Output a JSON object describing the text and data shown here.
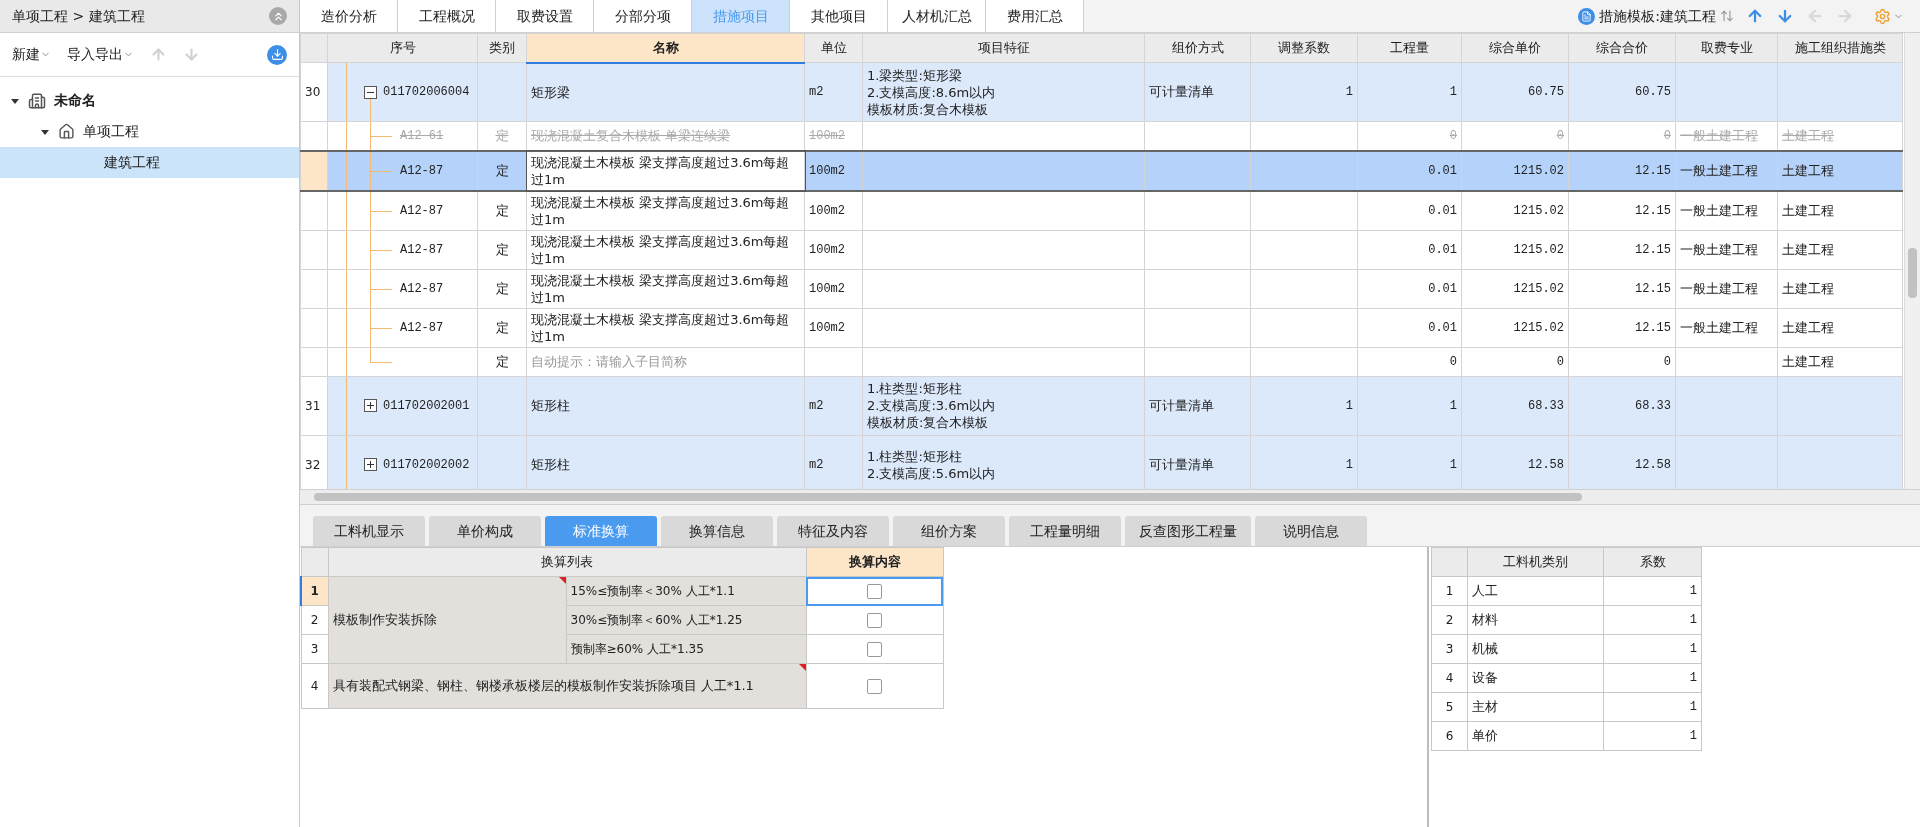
{
  "sidebar": {
    "breadcrumb": "单项工程 > 建筑工程",
    "menus": [
      {
        "label": "新建"
      },
      {
        "label": "导入导出"
      }
    ],
    "move_buttons": [
      {
        "kind": "up",
        "disabled": true
      },
      {
        "kind": "down",
        "disabled": true
      }
    ],
    "tree": [
      {
        "label": "未命名",
        "kind": "project",
        "expanded": true,
        "selected": false,
        "children": [
          {
            "label": "单项工程",
            "kind": "single",
            "expanded": true,
            "selected": false,
            "children": [
              {
                "label": "建筑工程",
                "selected": true
              }
            ]
          }
        ]
      }
    ]
  },
  "tabs": [
    {
      "label": "造价分析",
      "selected": false
    },
    {
      "label": "工程概况",
      "selected": false
    },
    {
      "label": "取费设置",
      "selected": false
    },
    {
      "label": "分部分项",
      "selected": false
    },
    {
      "label": "措施项目",
      "selected": true
    },
    {
      "label": "其他项目",
      "selected": false
    },
    {
      "label": "人材机汇总",
      "selected": false
    },
    {
      "label": "费用汇总",
      "selected": false
    }
  ],
  "template_selector": {
    "label": "措施模板:建筑工程"
  },
  "nav_buttons": [
    {
      "kind": "up",
      "disabled": false
    },
    {
      "kind": "down",
      "disabled": false
    },
    {
      "kind": "left",
      "disabled": true
    },
    {
      "kind": "right",
      "disabled": true
    }
  ],
  "table": {
    "columns": [
      {
        "label": "序号",
        "selected": false
      },
      {
        "label": "类别",
        "selected": false
      },
      {
        "label": "名称",
        "selected": true
      },
      {
        "label": "单位",
        "selected": false
      },
      {
        "label": "项目特征",
        "selected": false
      },
      {
        "label": "组价方式",
        "selected": false
      },
      {
        "label": "调整系数",
        "selected": false
      },
      {
        "label": "工程量",
        "selected": false
      },
      {
        "label": "综合单价",
        "selected": false
      },
      {
        "label": "综合合价",
        "selected": false
      },
      {
        "label": "取费专业",
        "selected": false
      },
      {
        "label": "施工组织措施类",
        "selected": false
      }
    ],
    "rows": [
      {
        "kind": "list",
        "num": "30",
        "code": "011702006004",
        "expanded": true,
        "name": "矩形梁",
        "unit": "m2",
        "features": [
          "1.梁类型:矩形梁",
          "2.支模高度:8.6m以内",
          "模板材质:复合木模板"
        ],
        "method": "可计量清单",
        "factor": "1",
        "qty": "1",
        "unit_price": "60.75",
        "total": "60.75",
        "selected": false
      },
      {
        "kind": "quota",
        "code": "A12-61",
        "category": "定",
        "name": "现浇混凝土复合木模板 单梁连续梁",
        "unit": "100m2",
        "qty": "0",
        "unit_price": "0",
        "total": "0",
        "fee_type": "一般土建工程",
        "measure_type": "土建工程",
        "struck": true,
        "selected": false
      },
      {
        "kind": "quota",
        "code": "A12-87",
        "category": "定",
        "name": "现浇混凝土木模板 梁支撑高度超过3.6m每超过1m",
        "unit": "100m2",
        "qty": "0.01",
        "unit_price": "1215.02",
        "total": "12.15",
        "fee_type": "一般土建工程",
        "measure_type": "土建工程",
        "struck": false,
        "selected": true
      },
      {
        "kind": "quota",
        "code": "A12-87",
        "category": "定",
        "name": "现浇混凝土木模板 梁支撑高度超过3.6m每超过1m",
        "unit": "100m2",
        "qty": "0.01",
        "unit_price": "1215.02",
        "total": "12.15",
        "fee_type": "一般土建工程",
        "measure_type": "土建工程",
        "struck": false,
        "selected": false
      },
      {
        "kind": "quota",
        "code": "A12-87",
        "category": "定",
        "name": "现浇混凝土木模板 梁支撑高度超过3.6m每超过1m",
        "unit": "100m2",
        "qty": "0.01",
        "unit_price": "1215.02",
        "total": "12.15",
        "fee_type": "一般土建工程",
        "measure_type": "土建工程",
        "struck": false,
        "selected": false
      },
      {
        "kind": "quota",
        "code": "A12-87",
        "category": "定",
        "name": "现浇混凝土木模板 梁支撑高度超过3.6m每超过1m",
        "unit": "100m2",
        "qty": "0.01",
        "unit_price": "1215.02",
        "total": "12.15",
        "fee_type": "一般土建工程",
        "measure_type": "土建工程",
        "struck": false,
        "selected": false
      },
      {
        "kind": "quota",
        "code": "A12-87",
        "category": "定",
        "name": "现浇混凝土木模板 梁支撑高度超过3.6m每超过1m",
        "unit": "100m2",
        "qty": "0.01",
        "unit_price": "1215.02",
        "total": "12.15",
        "fee_type": "一般土建工程",
        "measure_type": "土建工程",
        "struck": false,
        "selected": false
      },
      {
        "kind": "hint",
        "category": "定",
        "name": "自动提示：请输入子目简称",
        "qty": "0",
        "unit_price": "0",
        "total": "0",
        "measure_type": "土建工程",
        "selected": false
      },
      {
        "kind": "list",
        "num": "31",
        "code": "011702002001",
        "expanded": false,
        "name": "矩形柱",
        "unit": "m2",
        "features": [
          "1.柱类型:矩形柱",
          "2.支模高度:3.6m以内",
          "模板材质:复合木模板"
        ],
        "method": "可计量清单",
        "factor": "1",
        "qty": "1",
        "unit_price": "68.33",
        "total": "68.33",
        "selected": false
      },
      {
        "kind": "list",
        "num": "32",
        "code": "011702002002",
        "expanded": false,
        "name": "矩形柱",
        "unit": "m2",
        "features": [
          "1.柱类型:矩形柱",
          "2.支模高度:5.6m以内"
        ],
        "method": "可计量清单",
        "factor": "1",
        "qty": "1",
        "unit_price": "12.58",
        "total": "12.58",
        "selected": false
      }
    ]
  },
  "detail_tabs": [
    {
      "label": "工料机显示",
      "selected": false
    },
    {
      "label": "单价构成",
      "selected": false
    },
    {
      "label": "标准换算",
      "selected": true
    },
    {
      "label": "换算信息",
      "selected": false
    },
    {
      "label": "特征及内容",
      "selected": false
    },
    {
      "label": "组价方案",
      "selected": false
    },
    {
      "label": "工程量明细",
      "selected": false
    },
    {
      "label": "反查图形工程量",
      "selected": false
    },
    {
      "label": "说明信息",
      "selected": false
    }
  ],
  "conversion": {
    "columns": [
      "换算列表",
      "换算内容"
    ],
    "groups": [
      {
        "label": "模板制作安装拆除",
        "noted": true,
        "options": [
          {
            "num": "1",
            "text": "15%≤预制率＜30% 人工*1.1",
            "checked": false,
            "selected": true
          },
          {
            "num": "2",
            "text": "30%≤预制率＜60% 人工*1.25",
            "checked": false,
            "selected": false
          },
          {
            "num": "3",
            "text": "预制率≥60% 人工*1.35",
            "checked": false,
            "selected": false
          }
        ]
      },
      {
        "label": "具有装配式钢梁、钢柱、钢楼承板楼层的模板制作安装拆除项目 人工*1.1",
        "noted": true,
        "options": [
          {
            "num": "4",
            "checked": false,
            "selected": false
          }
        ]
      }
    ]
  },
  "coefficients": {
    "columns": [
      "工料机类别",
      "系数"
    ],
    "rows": [
      {
        "num": "1",
        "category": "人工",
        "value": "1"
      },
      {
        "num": "2",
        "category": "材料",
        "value": "1"
      },
      {
        "num": "3",
        "category": "机械",
        "value": "1"
      },
      {
        "num": "4",
        "category": "设备",
        "value": "1"
      },
      {
        "num": "5",
        "category": "主材",
        "value": "1"
      },
      {
        "num": "6",
        "category": "单价",
        "value": "1"
      }
    ]
  }
}
